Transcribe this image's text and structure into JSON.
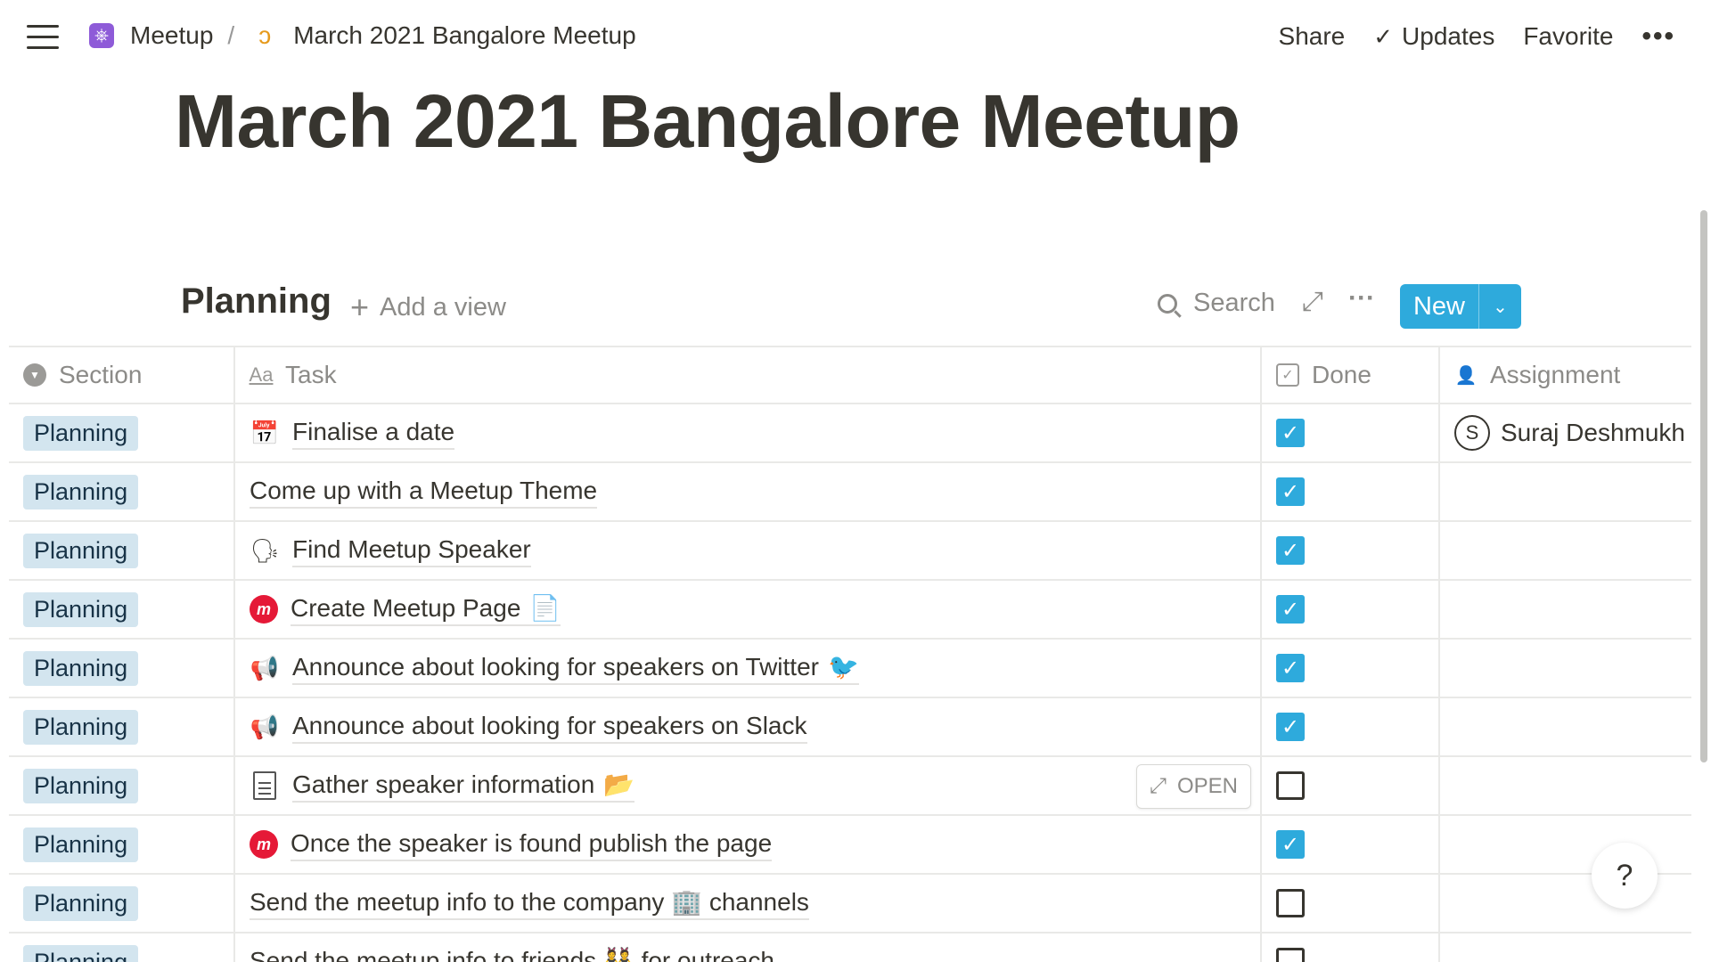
{
  "topbar": {
    "breadcrumbs": [
      {
        "label": "Meetup",
        "icon": "meetup-wheel-icon"
      },
      {
        "label": "March 2021 Bangalore Meetup",
        "icon": "orange-page-icon"
      }
    ],
    "separator": "/",
    "share_label": "Share",
    "updates_label": "Updates",
    "favorite_label": "Favorite",
    "more_label": "•••"
  },
  "page": {
    "title": "March 2021 Bangalore Meetup"
  },
  "view": {
    "name": "Planning",
    "add_view_label": "Add a view",
    "search_label": "Search",
    "new_label": "New",
    "accent_color": "#2eaadc"
  },
  "table": {
    "columns": [
      {
        "label": "Section",
        "icon": "select-icon"
      },
      {
        "label": "Task",
        "icon": "title-icon"
      },
      {
        "label": "Done",
        "icon": "checkbox-icon"
      },
      {
        "label": "Assignment",
        "icon": "person-icon"
      }
    ],
    "rows": [
      {
        "section": "Planning",
        "task": "Finalise a date",
        "icon": "calendar",
        "icon_glyph": "📅",
        "suffix": "",
        "done": true,
        "assignee": "Suraj Deshmukh",
        "avatar_initial": "S"
      },
      {
        "section": "Planning",
        "task": "Come up with a Meetup Theme",
        "icon": "",
        "icon_glyph": "",
        "suffix": "",
        "done": true,
        "assignee": "",
        "avatar_initial": ""
      },
      {
        "section": "Planning",
        "task": "Find Meetup Speaker",
        "icon": "speaking-head",
        "icon_glyph": "🗣",
        "suffix": "",
        "done": true,
        "assignee": "",
        "avatar_initial": ""
      },
      {
        "section": "Planning",
        "task": "Create Meetup Page",
        "icon": "meetup-logo",
        "icon_glyph": "m",
        "suffix": "📄",
        "done": true,
        "assignee": "",
        "avatar_initial": ""
      },
      {
        "section": "Planning",
        "task": "Announce about looking for speakers on Twitter",
        "icon": "megaphone",
        "icon_glyph": "📢",
        "suffix": "🐦",
        "done": true,
        "assignee": "",
        "avatar_initial": ""
      },
      {
        "section": "Planning",
        "task": "Announce about looking for speakers on Slack",
        "icon": "megaphone",
        "icon_glyph": "📢",
        "suffix": "",
        "done": true,
        "assignee": "",
        "avatar_initial": ""
      },
      {
        "section": "Planning",
        "task": "Gather speaker information",
        "icon": "document",
        "icon_glyph": "",
        "suffix": "📂",
        "done": false,
        "assignee": "",
        "avatar_initial": "",
        "hover_open": "OPEN"
      },
      {
        "section": "Planning",
        "task": "Once the speaker is found publish the page",
        "icon": "meetup-logo",
        "icon_glyph": "m",
        "suffix": "",
        "done": true,
        "assignee": "",
        "avatar_initial": ""
      },
      {
        "section": "Planning",
        "task": "Send the meetup info to the company 🏢 channels",
        "icon": "",
        "icon_glyph": "",
        "suffix": "",
        "done": false,
        "assignee": "",
        "avatar_initial": ""
      },
      {
        "section": "Planning",
        "task": "Send the meetup info to friends 👯 for outreach",
        "icon": "",
        "icon_glyph": "",
        "suffix": "",
        "done": false,
        "assignee": "",
        "avatar_initial": ""
      }
    ]
  },
  "help_label": "?"
}
